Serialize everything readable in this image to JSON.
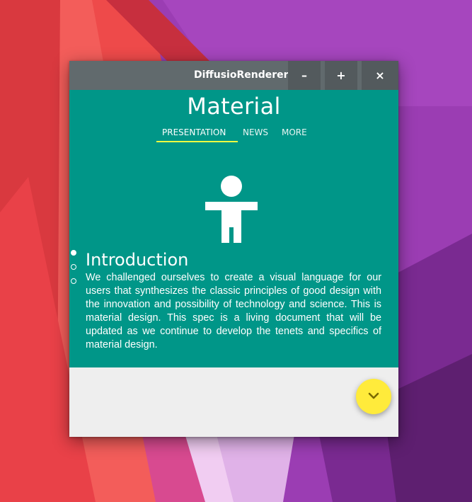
{
  "window": {
    "title": "DiffusioRenderer",
    "buttons": {
      "minimize": "–",
      "maximize": "+",
      "close": "×"
    }
  },
  "app": {
    "title": "Material",
    "tabs": [
      {
        "label": "PRESENTATION",
        "active": true
      },
      {
        "label": "NEWS",
        "active": false
      },
      {
        "label": "MORE",
        "active": false
      }
    ],
    "pager": {
      "count": 3,
      "active_index": 0
    },
    "section": {
      "heading": "Introduction",
      "body": "We challenged ourselves to create a visual language for our users that synthesizes the classic principles of good design with the innovation and possibility of technology and science. This is material design. This spec is a living document that will be updated as we continue to develop the tenets and specifics of material design."
    },
    "fab_icon": "chevron-down-icon",
    "hero_icon": "accessibility-person-icon"
  },
  "colors": {
    "header": "#009688",
    "titlebar": "#616a6d",
    "tab_indicator": "#eeff41",
    "fab": "#ffeb3b",
    "content_bg": "#eeeeee"
  }
}
